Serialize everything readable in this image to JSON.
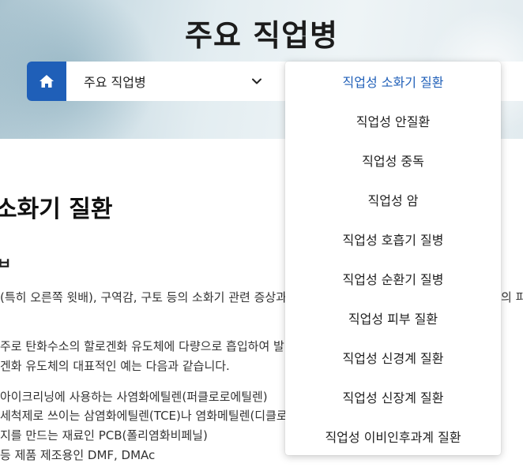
{
  "header": {
    "title": "주요 직업병"
  },
  "nav": {
    "home_icon": "home-icon",
    "selected": "주요 직업병",
    "chevron_icon": "chevron-down-icon"
  },
  "dropdown": {
    "items": [
      {
        "label": "직업성 소화기 질환",
        "active": true
      },
      {
        "label": "직업성 안질환",
        "active": false
      },
      {
        "label": "직업성 중독",
        "active": false
      },
      {
        "label": "직업성 암",
        "active": false
      },
      {
        "label": "직업성 호흡기 질병",
        "active": false
      },
      {
        "label": "직업성 순환기 질병",
        "active": false
      },
      {
        "label": "직업성 피부 질환",
        "active": false
      },
      {
        "label": "직업성 신경계 질환",
        "active": false
      },
      {
        "label": "직업성 신장계 질환",
        "active": false
      },
      {
        "label": "직업성 이비인후과계 질환",
        "active": false
      }
    ],
    "accent_color": "#1f5fb8"
  },
  "content": {
    "title": "소화기 질환",
    "subtitle": "ㅂ",
    "lines": [
      "(특히 오른쪽 윗배), 구역감, 구토 등의 소화기 관련 증상과",
      "의 피",
      "주로 탄화수소의 할로겐화 유도체에 다량으로 흡입하여 발",
      "겐화 유도체의 대표적인 예는 다음과 같습니다.",
      "아이크리닝에 사용하는 사염화에틸렌(퍼클로로에틸렌)",
      "세척제로 쓰이는 삼염화에틸렌(TCE)나 염화메틸렌(디클로",
      "지를 만드는 재료인 PCB(폴리염화비페닐)",
      "등 제품 제조용인 DMF, DMAc"
    ]
  }
}
